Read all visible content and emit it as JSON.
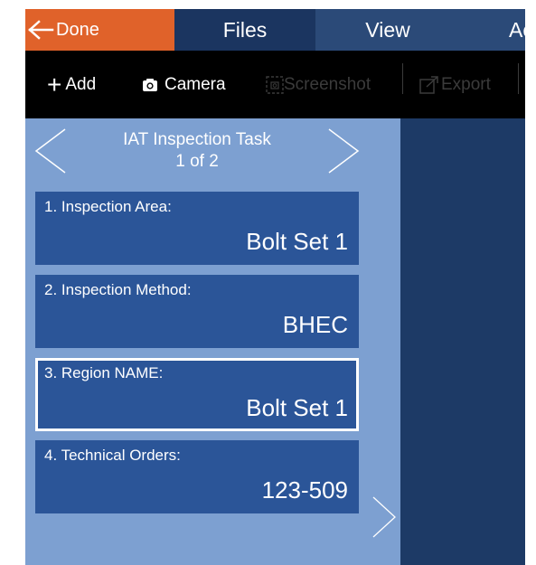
{
  "tabs": {
    "done": "Done",
    "files": "Files",
    "view": "View",
    "actions": "Ac"
  },
  "toolbar": {
    "add": "Add",
    "camera": "Camera",
    "screenshot": "Screenshot",
    "export": "Export"
  },
  "task": {
    "title": "IAT Inspection Task",
    "counter": "1 of 2"
  },
  "fields": [
    {
      "label": "1. Inspection Area:",
      "value": "Bolt Set 1"
    },
    {
      "label": "2. Inspection Method:",
      "value": "BHEC"
    },
    {
      "label": "3. Region NAME:",
      "value": "Bolt Set 1"
    },
    {
      "label": "4. Technical Orders:",
      "value": "123-509"
    }
  ],
  "colors": {
    "done_bg": "#e0622a",
    "tab_active": "#1b3560",
    "tab_inactive": "#2b4a78",
    "panel_bg": "#7da0d1",
    "field_bg": "#2b5598",
    "main_bg": "#1d3a66"
  }
}
